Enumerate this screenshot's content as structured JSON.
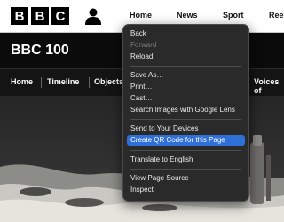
{
  "header": {
    "logo_letters": [
      "B",
      "B",
      "C"
    ],
    "nav": [
      "Home",
      "News",
      "Sport",
      "Reel"
    ]
  },
  "page_title": "BBC 100",
  "subnav": [
    "Home",
    "Timeline",
    "Objects",
    "Voices of"
  ],
  "context_menu": {
    "items": [
      "Back",
      "Forward",
      "Reload",
      "Save As…",
      "Print…",
      "Cast…",
      "Search Images with Google Lens",
      "Send to Your Devices",
      "Create QR Code for this Page",
      "Translate to English",
      "View Page Source",
      "Inspect"
    ],
    "disabled": [
      "Forward"
    ],
    "highlighted": "Create QR Code for this Page"
  },
  "colors": {
    "highlight": "#2f6fd8",
    "menu_bg": "#2a2a2a"
  }
}
